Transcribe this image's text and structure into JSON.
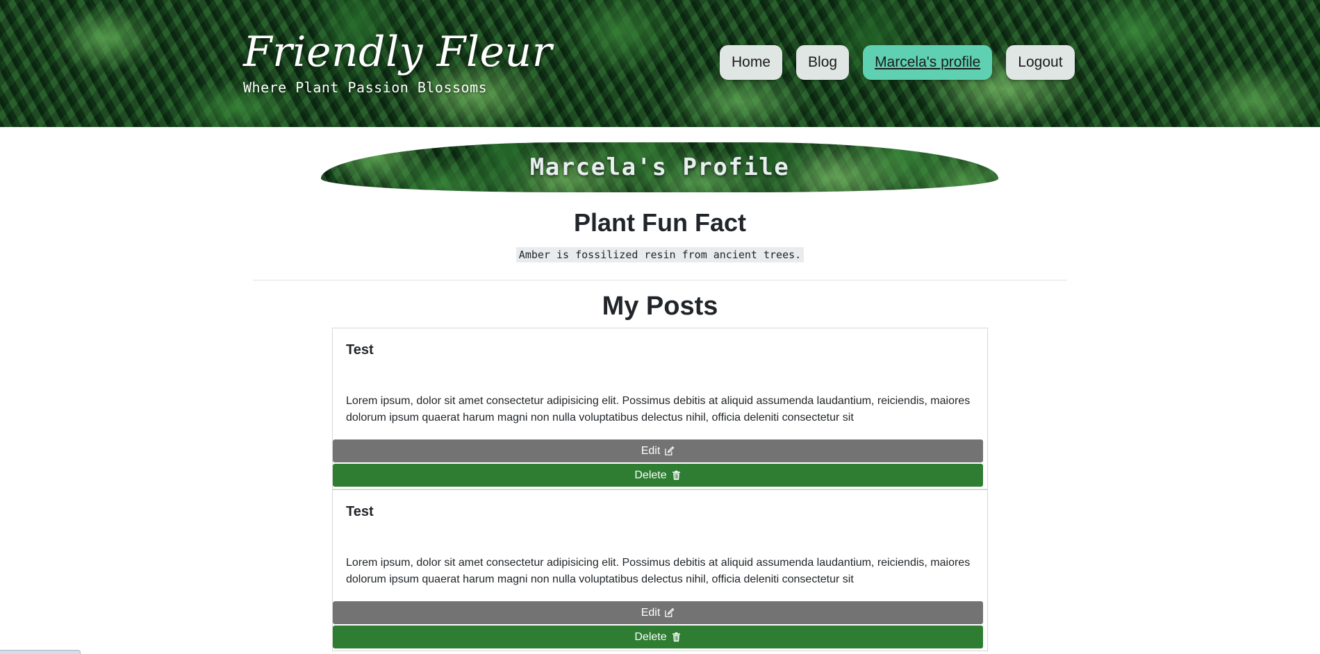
{
  "header": {
    "brand_title": "Friendly Fleur",
    "tagline": "Where Plant Passion Blossoms",
    "nav": [
      {
        "label": "Home",
        "active": false
      },
      {
        "label": "Blog",
        "active": false
      },
      {
        "label": "Marcela's profile",
        "active": true
      },
      {
        "label": "Logout",
        "active": false
      }
    ]
  },
  "profile": {
    "banner_title": "Marcela's Profile"
  },
  "fun_fact": {
    "title": "Plant Fun Fact",
    "text": "Amber is fossilized resin from ancient trees."
  },
  "posts_section": {
    "title": "My Posts",
    "posts": [
      {
        "title": "Test",
        "body": "Lorem ipsum, dolor sit amet consectetur adipisicing elit. Possimus debitis at aliquid assumenda laudantium, reiciendis, maiores dolorum ipsum quaerat harum magni non nulla voluptatibus delectus nihil, officia deleniti consectetur sit",
        "edit_label": "Edit",
        "delete_label": "Delete"
      },
      {
        "title": "Test",
        "body": "Lorem ipsum, dolor sit amet consectetur adipisicing elit. Possimus debitis at aliquid assumenda laudantium, reiciendis, maiores dolorum ipsum quaerat harum magni non nulla voluptatibus delectus nihil, officia deleniti consectetur sit",
        "edit_label": "Edit",
        "delete_label": "Delete"
      }
    ]
  },
  "icons": {
    "edit": "pencil-square-icon",
    "delete": "trash-icon"
  },
  "colors": {
    "active_nav": "#5fd0b2",
    "nav_button": "#dfe6e4",
    "edit_button": "#737373",
    "delete_button": "#2e7d32"
  }
}
